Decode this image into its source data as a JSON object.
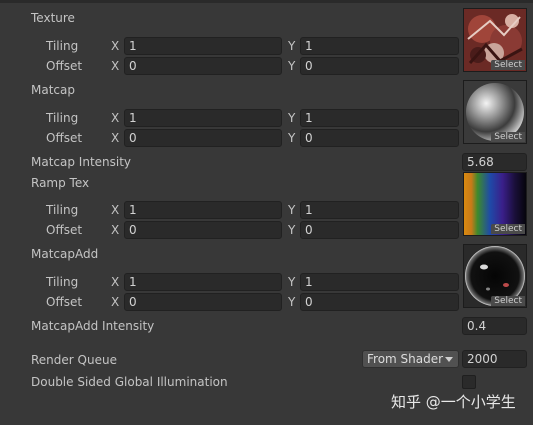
{
  "texture": {
    "label": "Texture",
    "tiling": {
      "label": "Tiling",
      "x": "1",
      "y": "1"
    },
    "offset": {
      "label": "Offset",
      "x": "0",
      "y": "0"
    },
    "select_label": "Select"
  },
  "matcap": {
    "label": "Matcap",
    "tiling": {
      "label": "Tiling",
      "x": "1",
      "y": "1"
    },
    "offset": {
      "label": "Offset",
      "x": "0",
      "y": "0"
    },
    "select_label": "Select"
  },
  "matcap_intensity": {
    "label": "Matcap Intensity",
    "value": "5.68"
  },
  "ramp_tex": {
    "label": "Ramp Tex",
    "tiling": {
      "label": "Tiling",
      "x": "1",
      "y": "1"
    },
    "offset": {
      "label": "Offset",
      "x": "0",
      "y": "0"
    },
    "select_label": "Select"
  },
  "matcap_add": {
    "label": "MatcapAdd",
    "tiling": {
      "label": "Tiling",
      "x": "1",
      "y": "1"
    },
    "offset": {
      "label": "Offset",
      "x": "0",
      "y": "0"
    },
    "select_label": "Select"
  },
  "matcap_add_intensity": {
    "label": "MatcapAdd Intensity",
    "value": "0.4"
  },
  "render_queue": {
    "label": "Render Queue",
    "mode": "From Shader",
    "value": "2000"
  },
  "double_sided_gi": {
    "label": "Double Sided Global Illumination",
    "checked": false
  },
  "axes": {
    "x": "X",
    "y": "Y"
  },
  "watermark": "知乎 @一个小学生"
}
